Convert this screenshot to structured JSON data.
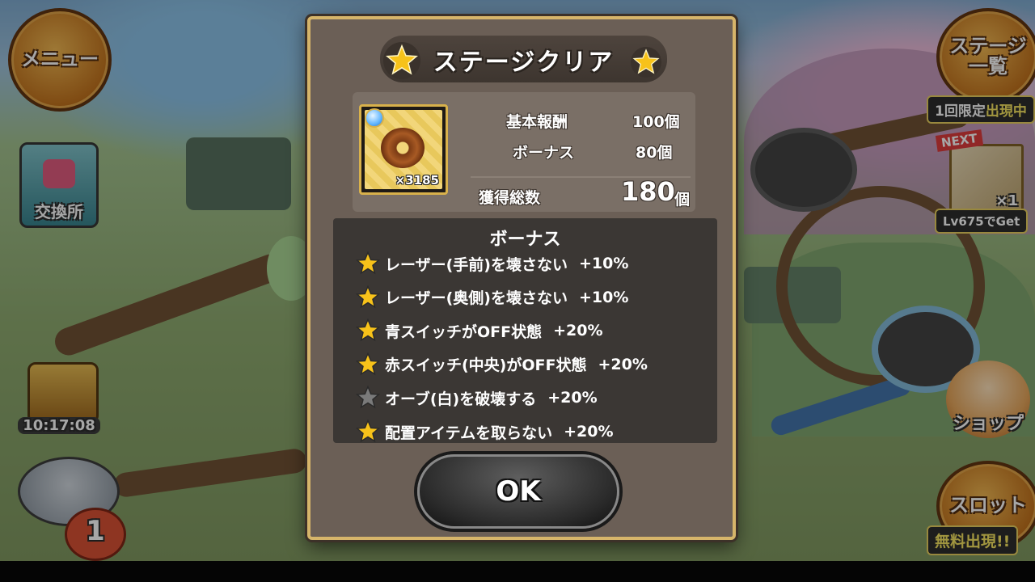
{
  "hud": {
    "menu_label": "メニュー",
    "exchange_label": "交換所",
    "chest_timer": "10:17:08",
    "character_count": "1",
    "stage_list_label": "ステージ\n一覧",
    "limited_tag_prefix": "1回限定",
    "limited_tag_suffix": "出現中",
    "next_label": "NEXT",
    "next_item_count": "×1",
    "next_unlock": "Lv675でGet",
    "shop_label": "ショップ",
    "slot_label": "スロット",
    "free_tag": "無料出現!!"
  },
  "dialog": {
    "title": "ステージクリア",
    "item_count": "×3185",
    "rewards": [
      {
        "label": "基本報酬",
        "value": "100個"
      },
      {
        "label": "ボーナス",
        "value": "80個"
      }
    ],
    "total_label": "獲得総数",
    "total_value": "180",
    "total_unit": "個",
    "bonus_title": "ボーナス",
    "bonuses": [
      {
        "label": "レーザー(手前)を壊さない",
        "pct": "+10%",
        "achieved": true
      },
      {
        "label": "レーザー(奥側)を壊さない",
        "pct": "+10%",
        "achieved": true
      },
      {
        "label": "青スイッチがOFF状態",
        "pct": "+20%",
        "achieved": true
      },
      {
        "label": "赤スイッチ(中央)がOFF状態",
        "pct": "+20%",
        "achieved": true
      },
      {
        "label": "オーブ(白)を破壊する",
        "pct": "+20%",
        "achieved": false
      },
      {
        "label": "配置アイテムを取らない",
        "pct": "+20%",
        "achieved": true
      }
    ],
    "ok_label": "OK"
  },
  "colors": {
    "star_gold": "#f7c21a",
    "star_gray": "#7a7a7a",
    "frame_gold": "#d6b56a"
  }
}
